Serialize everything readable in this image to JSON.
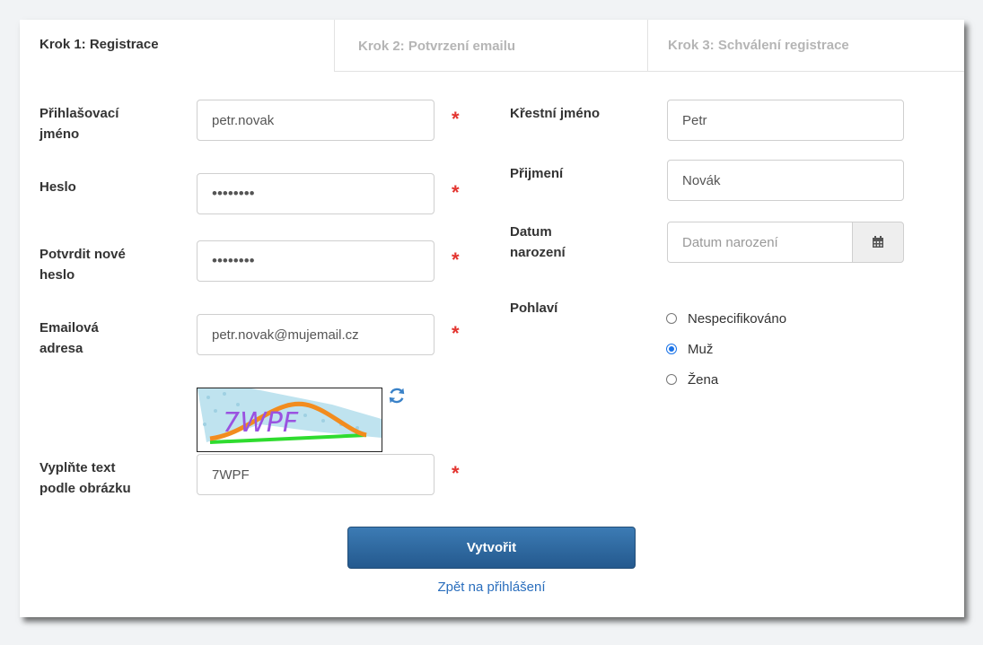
{
  "tabs": [
    {
      "label": "Krok 1: Registrace",
      "active": true
    },
    {
      "label": "Krok 2: Potvrzení emailu",
      "active": false
    },
    {
      "label": "Krok 3: Schválení registrace",
      "active": false
    }
  ],
  "form_left": {
    "username": {
      "label_line1": "Přihlašovací",
      "label_line2": "jméno",
      "value": "petr.novak"
    },
    "password": {
      "label": "Heslo",
      "value": "••••••••"
    },
    "confirm_password": {
      "label_line1": "Potvrdit nové",
      "label_line2": "heslo",
      "value": "••••••••"
    },
    "email": {
      "label_line1": "Emailová",
      "label_line2": "adresa",
      "value": "petr.novak@mujemail.cz"
    },
    "captcha": {
      "image_text": "7WPF",
      "label_line1": "Vyplňte text",
      "label_line2": "podle obrázku",
      "value": "7WPF"
    },
    "required_mark": "*"
  },
  "form_right": {
    "first_name": {
      "label": "Křestní jméno",
      "value": "Petr"
    },
    "last_name": {
      "label": "Přijmení",
      "value": "Novák"
    },
    "birth_date": {
      "label_line1": "Datum",
      "label_line2": "narození",
      "placeholder": "Datum narození"
    },
    "gender": {
      "label": "Pohlaví",
      "options": [
        {
          "label": "Nespecifikováno",
          "checked": false
        },
        {
          "label": "Muž",
          "checked": true
        },
        {
          "label": "Žena",
          "checked": false
        }
      ]
    }
  },
  "actions": {
    "submit_label": "Vytvořit",
    "back_link": "Zpět na přihlášení"
  },
  "colors": {
    "accent": "#2a6ebd",
    "button": "#2e6aa2",
    "required": "#e3342f",
    "radio": "#1a73e8"
  },
  "icons": [
    "refresh-icon",
    "calendar-icon"
  ]
}
